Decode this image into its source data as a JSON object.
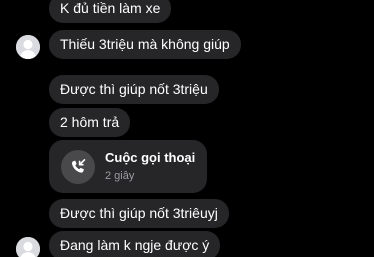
{
  "messages": [
    {
      "text": "K đủ tiền làm xe"
    },
    {
      "text": "Thiếu 3triệu mà không giúp"
    },
    {
      "text": "Được thì giúp nốt 3triệu"
    },
    {
      "text": "2 hôm trả"
    },
    {
      "text": "Được thì giúp nốt 3triêuyj"
    },
    {
      "text": "Đang làm k ngje được ý"
    }
  ],
  "call": {
    "title": "Cuộc gọi thoại",
    "duration": "2 giây",
    "icon": "missed-call-icon"
  },
  "colors": {
    "background": "#000000",
    "bubble": "#262628",
    "text": "#ffffff",
    "secondary_text": "#9b9ba0",
    "avatar": "#d9dbe0"
  }
}
